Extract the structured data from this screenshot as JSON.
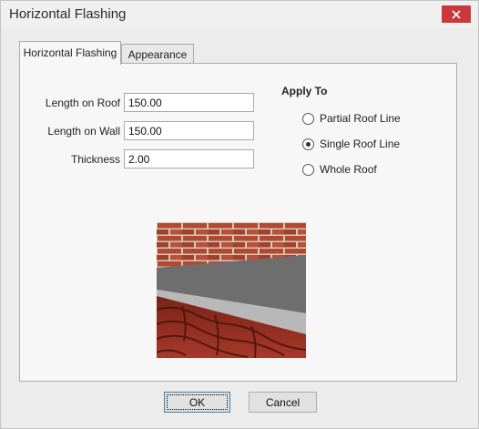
{
  "window": {
    "title": "Horizontal Flashing",
    "close_icon": "close-icon"
  },
  "tabs": [
    {
      "label": "Horizontal Flashing",
      "active": true
    },
    {
      "label": "Appearance",
      "active": false
    }
  ],
  "fields": {
    "length_on_roof": {
      "label": "Length on Roof",
      "value": "150.00"
    },
    "length_on_wall": {
      "label": "Length on Wall",
      "value": "150.00"
    },
    "thickness": {
      "label": "Thickness",
      "value": "2.00"
    }
  },
  "apply_to": {
    "title": "Apply To",
    "options": [
      {
        "label": "Partial Roof Line",
        "checked": false
      },
      {
        "label": "Single Roof Line",
        "checked": true
      },
      {
        "label": "Whole Roof",
        "checked": false
      }
    ]
  },
  "buttons": {
    "ok": "OK",
    "cancel": "Cancel"
  },
  "colors": {
    "close_button": "#c9383b",
    "brick": "#a8432f",
    "flashing": "#6e6e6e",
    "roof_tile": "#8f2a1f"
  }
}
